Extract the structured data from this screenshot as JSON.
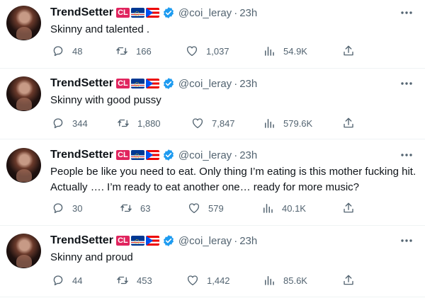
{
  "tweets": [
    {
      "name": "TrendSetter",
      "flag_label": "CL",
      "handle": "@coi_leray",
      "separator": "·",
      "time": "23h",
      "text": "Skinny and talented .",
      "replies": "48",
      "retweets": "166",
      "likes": "1,037",
      "views": "54.9K"
    },
    {
      "name": "TrendSetter",
      "flag_label": "CL",
      "handle": "@coi_leray",
      "separator": "·",
      "time": "23h",
      "text": "Skinny with good pussy",
      "replies": "344",
      "retweets": "1,880",
      "likes": "7,847",
      "views": "579.6K"
    },
    {
      "name": "TrendSetter",
      "flag_label": "CL",
      "handle": "@coi_leray",
      "separator": "·",
      "time": "23h",
      "text": "People be like you need to eat. Only thing I’m eating is this mother fucking hit. Actually …. I’m ready to eat another one… ready for more music?",
      "replies": "30",
      "retweets": "63",
      "likes": "579",
      "views": "40.1K"
    },
    {
      "name": "TrendSetter",
      "flag_label": "CL",
      "handle": "@coi_leray",
      "separator": "·",
      "time": "23h",
      "text": "Skinny and proud",
      "replies": "44",
      "retweets": "453",
      "likes": "1,442",
      "views": "85.6K"
    }
  ],
  "colors": {
    "verified": "#1d9bf0",
    "icon_gray": "#536471",
    "separator": "#eff3f4"
  }
}
